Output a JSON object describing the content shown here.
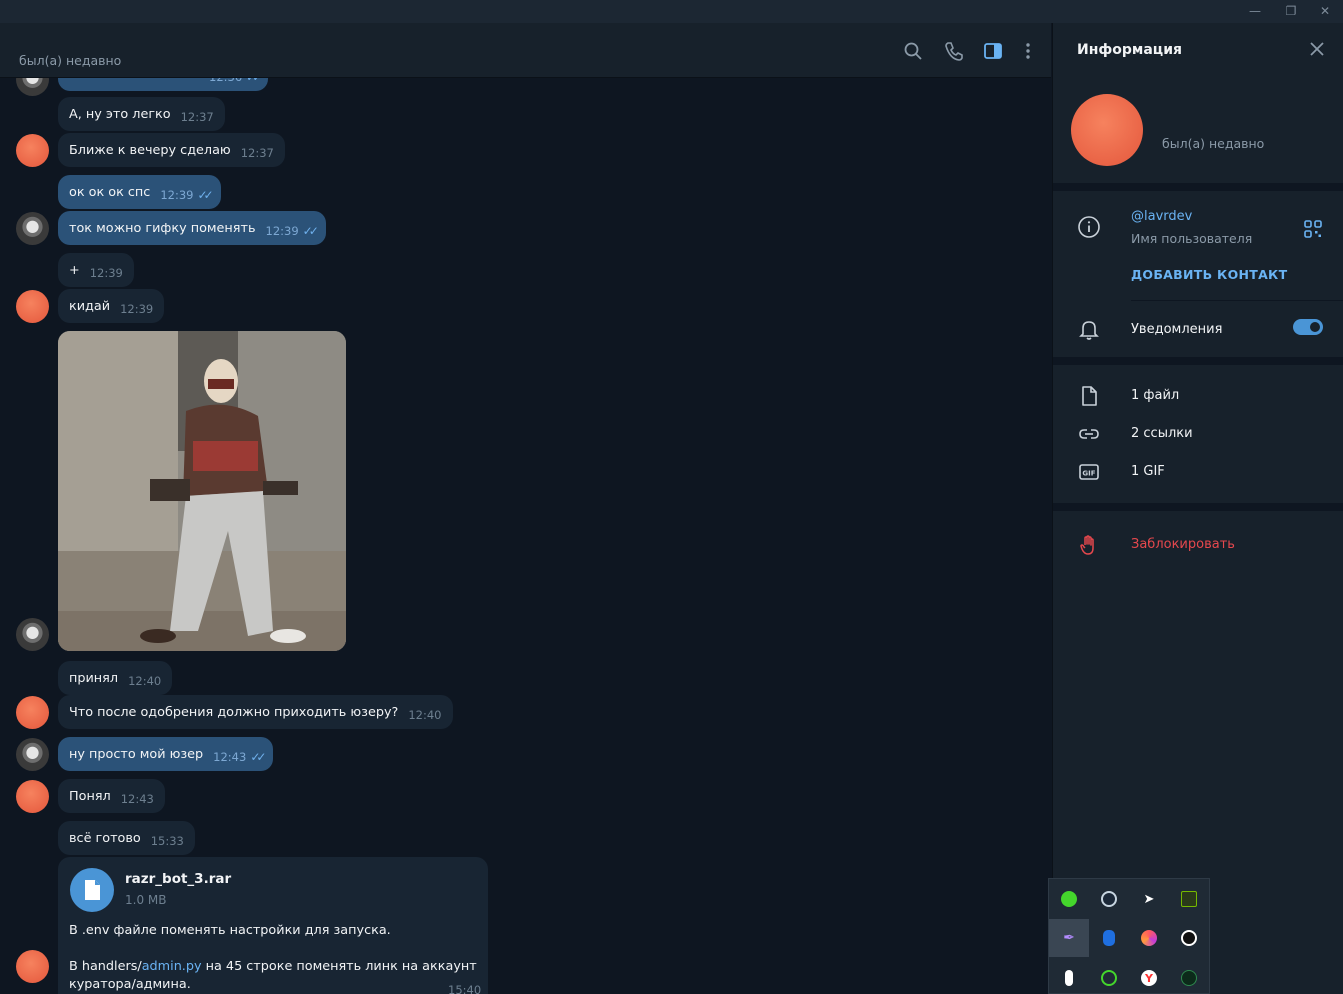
{
  "header": {
    "status": "был(а) недавно"
  },
  "messages": [
    {
      "text": "А, ну это легко",
      "time": "12:37",
      "out": false
    },
    {
      "text": "Ближе к вечеру сделаю",
      "time": "12:37",
      "out": false
    },
    {
      "text": "ок ок ок спс",
      "time": "12:39",
      "out": true
    },
    {
      "text": "ток можно гифку поменять",
      "time": "12:39",
      "out": true
    },
    {
      "text": "+",
      "time": "12:39",
      "out": false
    },
    {
      "text": "кидай",
      "time": "12:39",
      "out": false
    },
    {
      "text": "принял",
      "time": "12:40",
      "out": false
    },
    {
      "text": "Что после одобрения должно приходить юзеру?",
      "time": "12:40",
      "out": false
    },
    {
      "text": "ну просто мой юзер",
      "time": "12:43",
      "out": true
    },
    {
      "text": "Понял",
      "time": "12:43",
      "out": false
    },
    {
      "text": "всё готово",
      "time": "15:33",
      "out": false
    }
  ],
  "top_partial_time": "12:36",
  "file_message": {
    "file_name": "razr_bot_3.rar",
    "file_size": "1.0 MB",
    "line1": "В .env файле поменять настройки для запуска.",
    "line2_prefix": "В handlers/",
    "line2_link": "admin.py",
    "line2_suffix": " на 45 строке поменять линк на аккаунт",
    "line3": "куратора/админа.",
    "time": "15:40"
  },
  "info_panel": {
    "title": "Информация",
    "last_seen": "был(а) недавно",
    "username": "@lavrdev",
    "username_label": "Имя пользователя",
    "add_contact": "ДОБАВИТЬ КОНТАКТ",
    "notifications": "Уведомления",
    "notifications_on": true,
    "files": "1 файл",
    "links": "2 ссылки",
    "gifs": "1 GIF",
    "block": "Заблокировать"
  },
  "colors": {
    "accent": "#6ab3f3",
    "toggle": "#4a95d6",
    "danger": "#e5484d",
    "outgoing_bubble": "#2b5278",
    "incoming_bubble": "#182533"
  },
  "tray_icons": [
    "razer-icon",
    "steam-icon",
    "telegram-icon",
    "nvidia-icon",
    "feather-icon",
    "bluetooth-icon",
    "swirl-icon",
    "logitech-icon",
    "microphone-icon",
    "razer-icon-2",
    "yandex-icon",
    "green-circle-icon"
  ]
}
